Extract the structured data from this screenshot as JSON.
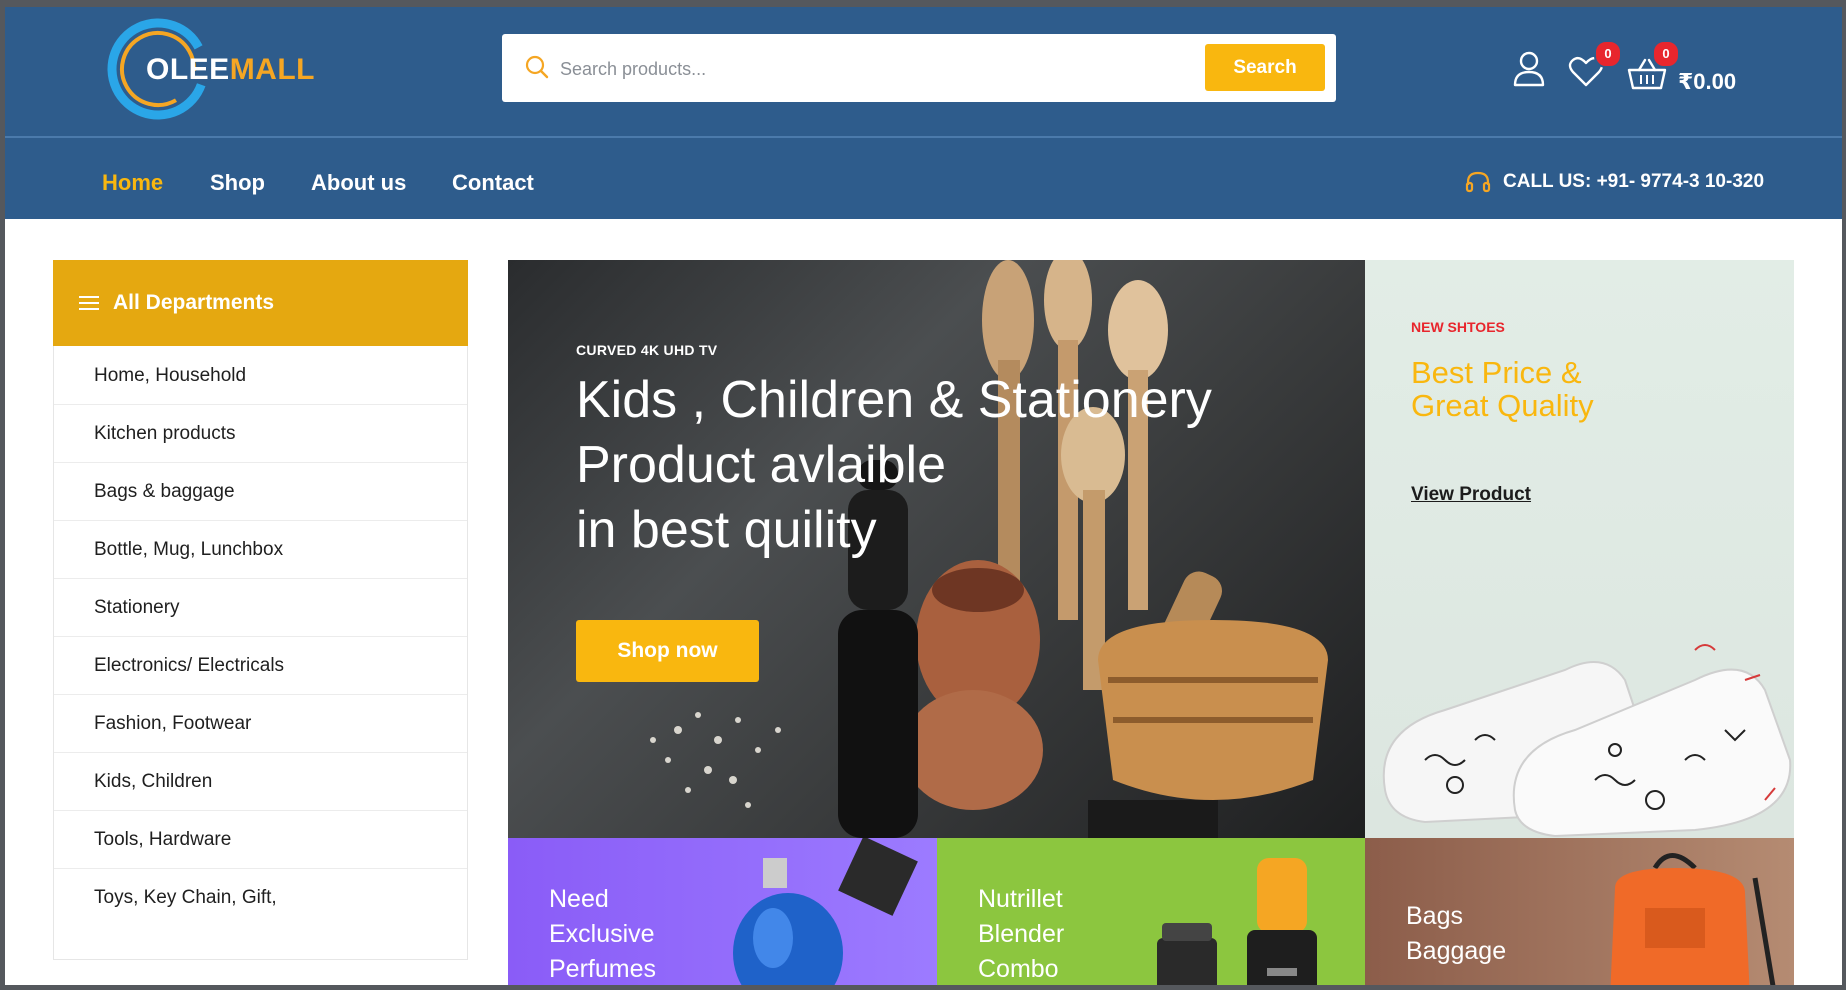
{
  "header": {
    "logo": {
      "part1": "OLEE",
      "part2": "MALL"
    },
    "search": {
      "placeholder": "Search products...",
      "button_label": "Search"
    },
    "wishlist_count": "0",
    "cart_count": "0",
    "cart_total": "₹0.00"
  },
  "nav": {
    "links": [
      {
        "label": "Home",
        "active": true
      },
      {
        "label": "Shop"
      },
      {
        "label": "About us"
      },
      {
        "label": "Contact"
      }
    ],
    "call": "CALL US: +91- 9774-3 10-320"
  },
  "departments": {
    "title": "All Departments",
    "items": [
      "Home, Household",
      "Kitchen products",
      "Bags & baggage",
      "Bottle, Mug, Lunchbox",
      "Stationery",
      "Electronics/ Electricals",
      "Fashion, Footwear",
      "Kids, Children",
      "Tools, Hardware",
      "Toys, Key Chain, Gift,"
    ]
  },
  "hero": {
    "kicker": "CURVED 4K UHD TV",
    "title_lines": [
      "Kids , Children & Stationery",
      "Product avlaible",
      "in best quility"
    ],
    "button_label": "Shop now"
  },
  "side_promo": {
    "kicker": "NEW SHTOES",
    "title_lines": [
      "Best Price &",
      "Great Quality"
    ],
    "link_label": "View Product"
  },
  "tiles": [
    {
      "lines": [
        "Need",
        "Exclusive",
        "Perfumes"
      ]
    },
    {
      "lines": [
        "Nutrillet",
        "Blender",
        "Combo"
      ]
    },
    {
      "lines": [
        "Bags",
        "Baggage"
      ]
    }
  ],
  "colors": {
    "header_bg": "#2e5c8c",
    "accent": "#f9b70f",
    "badge": "#e8262d"
  }
}
